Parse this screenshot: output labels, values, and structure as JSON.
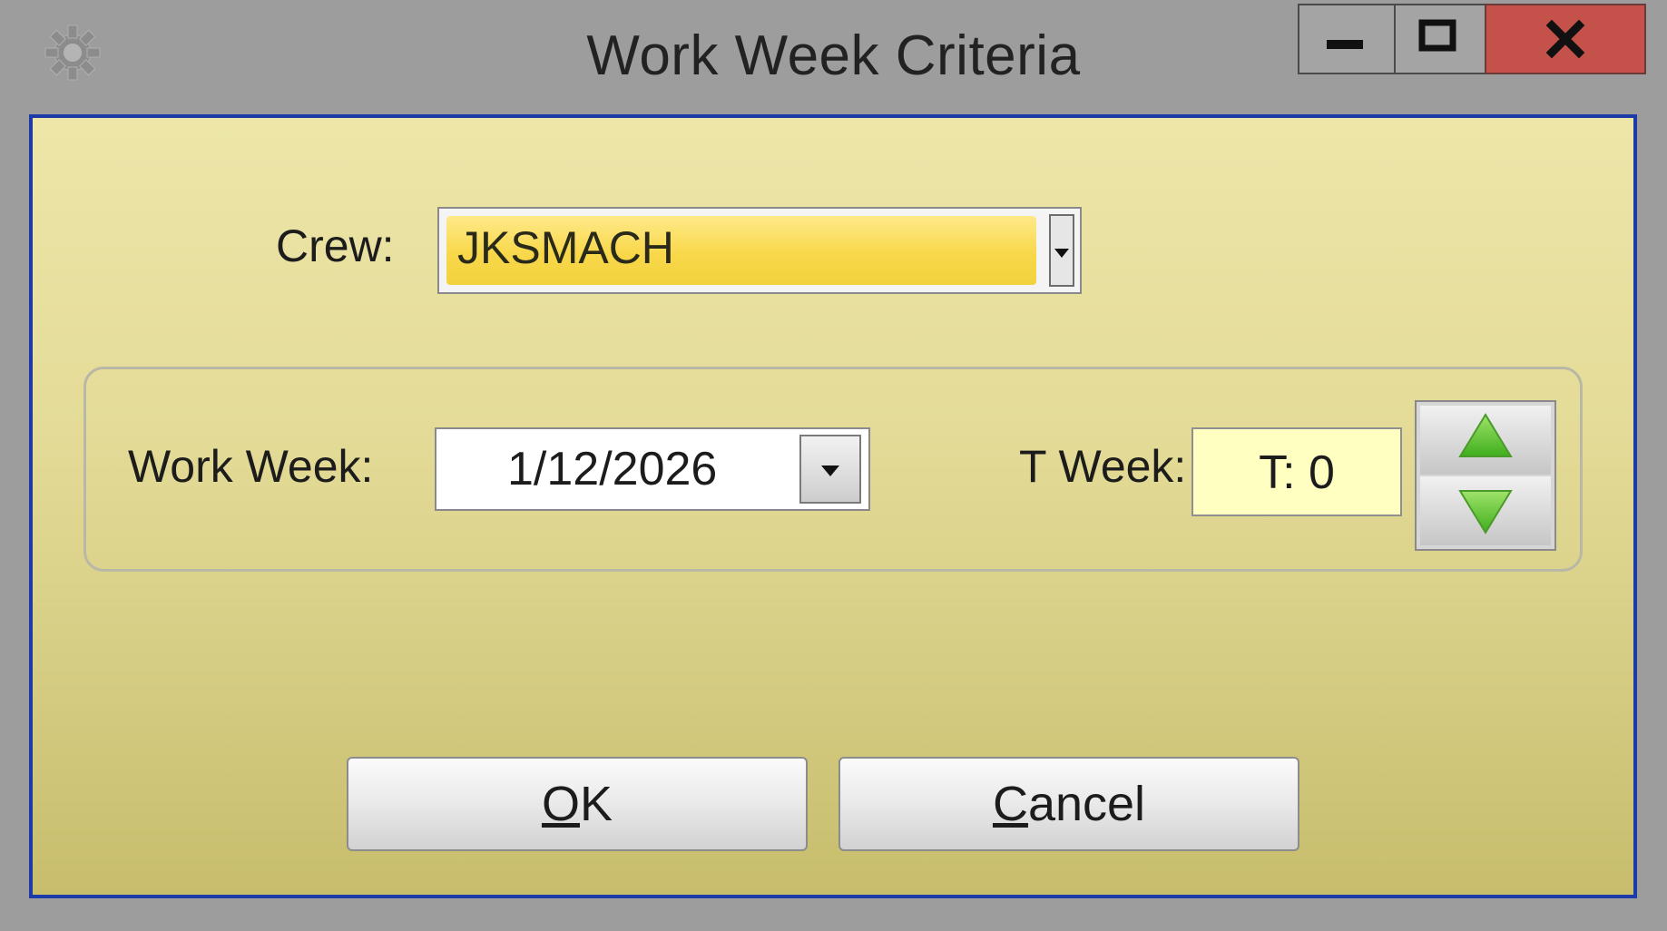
{
  "window": {
    "title": "Work Week Criteria"
  },
  "icons": {
    "app": "gear-icon",
    "minimize": "minimize-icon",
    "maximize": "maximize-icon",
    "close": "close-icon",
    "crew_dropdown": "chevron-down-icon",
    "date_dropdown": "chevron-down-icon",
    "spin_up": "triangle-up-icon",
    "spin_down": "triangle-down-icon"
  },
  "crew": {
    "label": "Crew:",
    "value": "JKSMACH"
  },
  "work_week": {
    "label": "Work Week:",
    "value": "1/12/2026"
  },
  "t_week": {
    "label": "T Week:",
    "value": "T: 0"
  },
  "buttons": {
    "ok_mnemonic": "O",
    "ok_rest": "K",
    "cancel_mnemonic": "C",
    "cancel_rest": "ancel"
  },
  "colors": {
    "close_button": "#c4524a",
    "client_border": "#1e3aa8",
    "crew_highlight": "#f8d84a",
    "tweek_background": "#ffffc2",
    "spinner_arrow": "#5cc62a"
  }
}
